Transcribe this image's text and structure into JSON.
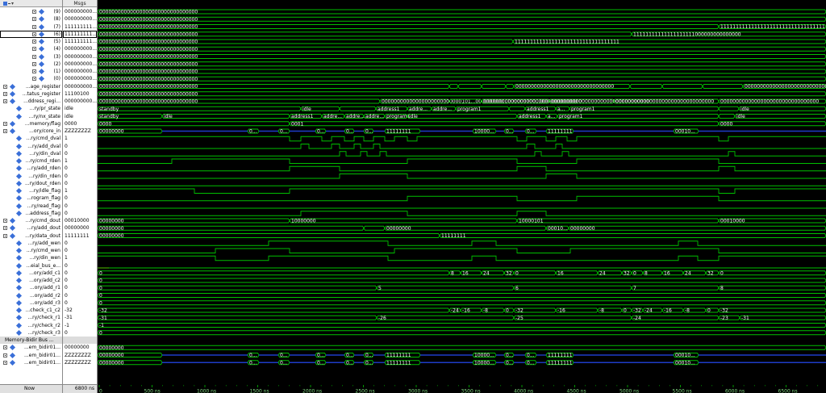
{
  "header": {
    "values_title": "Msgs"
  },
  "now": {
    "label": "Now",
    "value": "6800 ns"
  },
  "signals": [
    {
      "name": "(9)",
      "value": "000000000...",
      "indent": 2,
      "expand": true
    },
    {
      "name": "(8)",
      "value": "000000000...",
      "indent": 2,
      "expand": true
    },
    {
      "name": "(7)",
      "value": "111111111...",
      "indent": 2,
      "expand": true
    },
    {
      "name": "(6)",
      "value": "111111111...",
      "indent": 2,
      "expand": true,
      "selected": true
    },
    {
      "name": "(5)",
      "value": "111111111...",
      "indent": 2,
      "expand": true
    },
    {
      "name": "(4)",
      "value": "000000000...",
      "indent": 2,
      "expand": true
    },
    {
      "name": "(3)",
      "value": "000000000...",
      "indent": 2,
      "expand": true
    },
    {
      "name": "(2)",
      "value": "000000000...",
      "indent": 2,
      "expand": true
    },
    {
      "name": "(1)",
      "value": "000000000...",
      "indent": 2,
      "expand": true
    },
    {
      "name": "(0)",
      "value": "000000000...",
      "indent": 2,
      "expand": true
    },
    {
      "name": "...age_register",
      "value": "000000000...",
      "indent": 0,
      "expand": true
    },
    {
      "name": "...tatus_register",
      "value": "11100100",
      "indent": 0,
      "expand": true
    },
    {
      "name": "...ddress_regi...",
      "value": "000000000...",
      "indent": 0,
      "expand": true
    },
    {
      "name": "...ry/pr_state",
      "value": "idle",
      "indent": 1
    },
    {
      "name": "...ry/nx_state",
      "value": "idle",
      "indent": 1
    },
    {
      "name": "...memory/flag",
      "value": "0000",
      "indent": 0,
      "expand": true
    },
    {
      "name": "...ory/core_in",
      "value": "ZZZZZZZZ",
      "indent": 0,
      "expand": true
    },
    {
      "name": "...ry/cmd_dval",
      "value": "1",
      "indent": 1
    },
    {
      "name": "...ry/add_dval",
      "value": "0",
      "indent": 1
    },
    {
      "name": "...ry/din_dval",
      "value": "0",
      "indent": 1
    },
    {
      "name": "...ry/cmd_rden",
      "value": "1",
      "indent": 1
    },
    {
      "name": "...ry/add_rden",
      "value": "0",
      "indent": 1
    },
    {
      "name": "...ry/din_rden",
      "value": "0",
      "indent": 1
    },
    {
      "name": "...ry/dout_rden",
      "value": "0",
      "indent": 1
    },
    {
      "name": "...ry/idle_flag",
      "value": "1",
      "indent": 1
    },
    {
      "name": "...rogram_flag",
      "value": "0",
      "indent": 1
    },
    {
      "name": "...ry/read_flag",
      "value": "0",
      "indent": 1
    },
    {
      "name": "...address_flag",
      "value": "0",
      "indent": 1
    },
    {
      "name": "...ry/cmd_dout",
      "value": "00010000",
      "indent": 0,
      "expand": true
    },
    {
      "name": "...ry/add_dout",
      "value": "00000000",
      "indent": 0,
      "expand": true
    },
    {
      "name": "...ry/data_dout",
      "value": "11111111",
      "indent": 0,
      "expand": true
    },
    {
      "name": "...ry/add_wen",
      "value": "0",
      "indent": 1
    },
    {
      "name": "...ry/cmd_wen",
      "value": "0",
      "indent": 1
    },
    {
      "name": "...ry/din_wen",
      "value": "1",
      "indent": 1
    },
    {
      "name": "...eial_bus_e...",
      "value": "0",
      "indent": 1
    },
    {
      "name": "...ory/add_c1",
      "value": "0",
      "indent": 1
    },
    {
      "name": "...ory/add_c2",
      "value": "0",
      "indent": 1
    },
    {
      "name": "...ory/add_r1",
      "value": "0",
      "indent": 1
    },
    {
      "name": "...ory/add_r2",
      "value": "0",
      "indent": 1
    },
    {
      "name": "...ory/add_r3",
      "value": "0",
      "indent": 1
    },
    {
      "name": "...check_c1_c2",
      "value": "-32",
      "indent": 1
    },
    {
      "name": "...ry/check_r1",
      "value": "-31",
      "indent": 1
    },
    {
      "name": "...ry/check_r2",
      "value": "-1",
      "indent": 1
    },
    {
      "name": "...ry/check_r3",
      "value": "0",
      "indent": 1
    },
    {
      "name": "Memory-Bidir Bus ...",
      "value": "",
      "group": true
    },
    {
      "name": "...em_bidir01...",
      "value": "00000000",
      "indent": 0,
      "expand": true
    },
    {
      "name": "...em_bidir01...",
      "value": "ZZZZZZZZ",
      "indent": 0,
      "expand": true
    },
    {
      "name": "...em_bidir01...",
      "value": "ZZZZZZZZ",
      "indent": 0,
      "expand": true
    }
  ],
  "wave_labels": {
    "long_zero": "00000000000000000000000000000000",
    "long_one": "1111111111111111111111111111111111",
    "r6_second": "11111111111111111111000000000000000",
    "r5_second": "1111111111111111111111111111111111",
    "r_ones": "11111111",
    "standby": "standby",
    "idle": "idle",
    "address1": "address1",
    "addre": "addre...",
    "program1": "program1",
    "a": "a...",
    "flag1": "0001",
    "flag0": "0000",
    "core": "00000000",
    "z0": "0...",
    "core_mid": "10000...",
    "core_end": "00010...",
    "cmd_dout": "10000000",
    "cmd_dout2": "00010000",
    "cmd_dout3": "10000101",
    "add_dout1": "00000000",
    "add_dout2": "00010...",
    "data_dout": "11111111",
    "v0": "0",
    "v5": "5",
    "v6": "6",
    "v7": "7",
    "v8": "8",
    "v16": "16",
    "v24": "24",
    "v32": "32",
    "m32": "-32",
    "m31": "-31",
    "m1": "-1",
    "m24": "-24",
    "m16": "-16",
    "m8": "-8",
    "m26": "-26",
    "m25": "-25",
    "m23": "-23",
    "reg_mix": "000000...0...00000000000...00000000000...000000000000...00000",
    "status_mix": "00000000000000000000000000101...000000000...000000000...000000000000"
  },
  "ruler": {
    "ticks": [
      "0",
      "500 ns",
      "1000 ns",
      "1500 ns",
      "2000 ns",
      "2500 ns",
      "3000 ns",
      "3500 ns",
      "4000 ns",
      "4500 ns",
      "5000 ns",
      "5500 ns",
      "6000 ns",
      "6500 ns"
    ]
  },
  "colors": {
    "wave": "#00c000",
    "bus_z": "#1e3cc8",
    "marker": "#c80000",
    "text": "#ffffff",
    "bg": "#000000"
  }
}
